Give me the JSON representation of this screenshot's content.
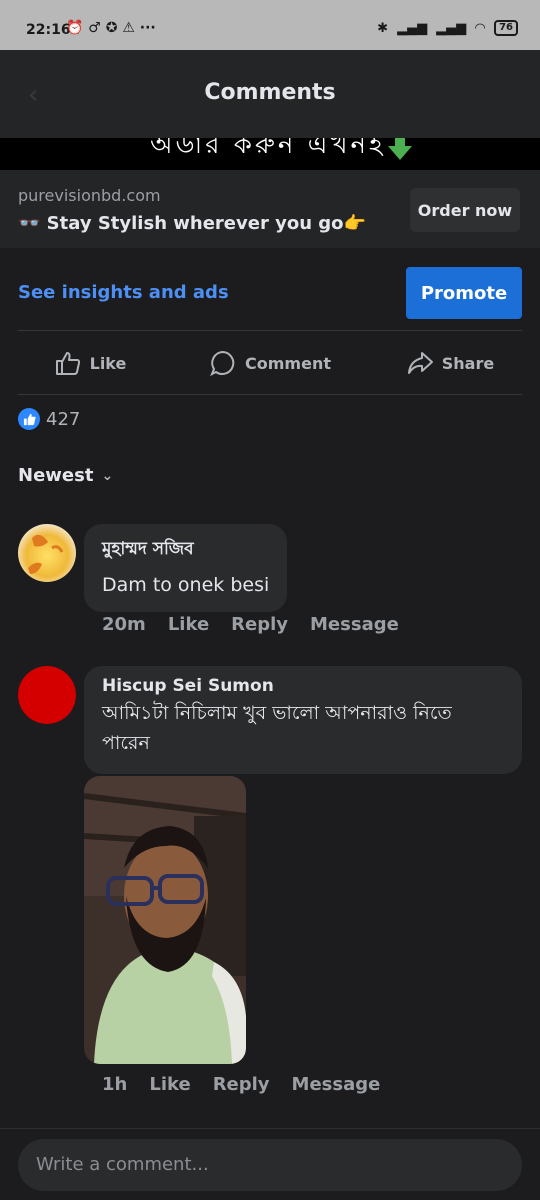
{
  "status": {
    "time": "22:16",
    "left_icons": "⏰ ♂ ✪ ⚠ ···",
    "battery": "76"
  },
  "header": {
    "title": "Comments"
  },
  "ad": {
    "domain": "purevisionbd.com",
    "tagline": "👓 Stay Stylish wherever you go👉",
    "cta": "Order now",
    "strip_text": "অর্ডার করুন এখনই"
  },
  "insights": {
    "link": "See insights and ads",
    "promote": "Promote"
  },
  "actions": {
    "like": "Like",
    "comment": "Comment",
    "share": "Share"
  },
  "reactions": {
    "count": "427"
  },
  "sort": {
    "label": "Newest"
  },
  "comments": [
    {
      "author": "মুহাম্মদ সজিব",
      "text": "Dam to onek besi",
      "time": "20m",
      "like": "Like",
      "reply": "Reply",
      "message": "Message"
    },
    {
      "author": "Hiscup Sei Sumon",
      "text": "আমি১টা নিচিলাম খুব ভালো আপনারাও নিতে পারেন",
      "time": "1h",
      "like": "Like",
      "reply": "Reply",
      "message": "Message"
    }
  ],
  "composer": {
    "placeholder": "Write a comment..."
  },
  "colors": {
    "accent": "#1b6fd6",
    "link": "#4d8ff5",
    "background": "#1c1c1e"
  }
}
